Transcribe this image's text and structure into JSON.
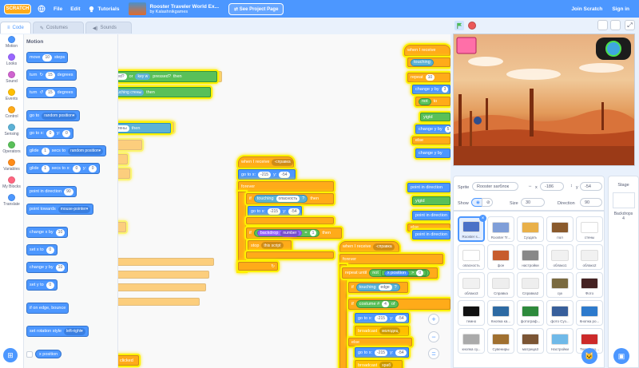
{
  "topbar": {
    "logo": "SCRATCH",
    "file": "File",
    "edit": "Edit",
    "tutorials": "Tutorials",
    "project_title": "Rooster Traveler World Ex...",
    "project_by": "by Kalashnikgames",
    "see_project": "See Project Page",
    "join": "Join Scratch",
    "sign_in": "Sign in"
  },
  "tabs": {
    "code": "Code",
    "costumes": "Costumes",
    "sounds": "Sounds"
  },
  "categories": [
    {
      "label": "Motion",
      "color": "#4c97ff"
    },
    {
      "label": "Looks",
      "color": "#9966ff"
    },
    {
      "label": "Sound",
      "color": "#cf63cf"
    },
    {
      "label": "Events",
      "color": "#ffbf00"
    },
    {
      "label": "Control",
      "color": "#ffab19"
    },
    {
      "label": "Sensing",
      "color": "#5cb1d6"
    },
    {
      "label": "Operators",
      "color": "#59c059"
    },
    {
      "label": "Variables",
      "color": "#ff8c1a"
    },
    {
      "label": "My Blocks",
      "color": "#ff6680"
    },
    {
      "label": "Translate",
      "color": "#4c97ff"
    }
  ],
  "palette": {
    "heading": "Motion",
    "move": {
      "a": "move",
      "v": "10",
      "b": "steps"
    },
    "turn_right": {
      "a": "turn",
      "v": "15",
      "b": "degrees"
    },
    "turn_left": {
      "a": "turn",
      "v": "15",
      "b": "degrees"
    },
    "goto": {
      "a": "go to",
      "d": "random position"
    },
    "gotoxy": {
      "a": "go to x:",
      "x": "0",
      "b": "y:",
      "y": "0"
    },
    "glide": {
      "a": "glide",
      "v": "1",
      "b": "secs to",
      "d": "random position"
    },
    "glidexy": {
      "a": "glide",
      "v": "1",
      "b": "secs to x:",
      "x": "0",
      "c": "y:",
      "y": "0"
    },
    "point_dir": {
      "a": "point in direction",
      "v": "90"
    },
    "point_towards": {
      "a": "point towards",
      "d": "mouse-pointer"
    },
    "change_x": {
      "a": "change x by",
      "v": "10"
    },
    "set_x": {
      "a": "set x to",
      "v": "0"
    },
    "change_y": {
      "a": "change y by",
      "v": "10"
    },
    "set_y": {
      "a": "set y to",
      "v": "0"
    },
    "bounce": "if on edge, bounce",
    "rotation": {
      "a": "set rotation style",
      "d": "left-right"
    },
    "xpos": "x position"
  },
  "workspace": {
    "script1": {
      "hat": "when I receive",
      "hat_msg": "-справка",
      "goto": "go to x:",
      "x": "-215",
      "y_label": "y:",
      "y": "-54",
      "forever": "forever",
      "if1": "if",
      "touching": "touching",
      "touching_arg": "опасность",
      "q": "?",
      "then": "then",
      "backdrop": "backdrop",
      "backdrop_arg": "number",
      "eq": "=",
      "eq_val": "1",
      "stop": "stop",
      "stop_arg": "this script"
    },
    "script2": {
      "hat": "when I receive",
      "hat_msg": "-справка",
      "forever": "forever",
      "repeat_until": "repeat until",
      "not": "not",
      "xpos": "x position",
      "gt": ">",
      "val": "0",
      "touching": "touching",
      "edge": "edge",
      "costume": "costume #",
      "of": "of",
      "num": "4",
      "x": "-215",
      "y": "-54",
      "broadcast": "broadcast",
      "msg1": "молодец",
      "else": "else",
      "msg2": "храб"
    },
    "script3": {
      "hat": "when I receive",
      "touching": "touching",
      "repeat": "repeat",
      "num10": "10",
      "change_y": "change y by",
      "val3": "3",
      "not": "not",
      "to": "to",
      "yigtd": "yigtd",
      "change_y2": "change y by",
      "val5": "5",
      "else": "else",
      "point_dir": "point in direction",
      "dir": "90",
      "dir2": "-90"
    },
    "faded": {
      "pressed": "pressed?",
      "or": "or",
      "key": "key",
      "w": "w",
      "touching_walls": "touching",
      "walls": "стены",
      "then": "then",
      "clicked": "clicked"
    },
    "zoom_in": "+",
    "zoom_out": "−",
    "zoom_reset": "="
  },
  "sprite_info": {
    "sprite_label": "Sprite",
    "sprite_name": "Rooster sarблок",
    "x_label": "x",
    "x": "-186",
    "y_label": "y",
    "y": "-54",
    "show_label": "Show",
    "size_label": "Size",
    "size": "30",
    "direction_label": "Direction",
    "direction": "90"
  },
  "sprites": [
    {
      "name": "Rooster s...",
      "color": "#4b71c7",
      "selected": true
    },
    {
      "name": "Rooster Tr...",
      "color": "#7f9ed8"
    },
    {
      "name": "Cуздать",
      "color": "#e9b048"
    },
    {
      "name": "пол",
      "color": "#8a5a2c"
    },
    {
      "name": "стены",
      "color": "#ffffff"
    },
    {
      "name": "опасность",
      "color": "#ffffff"
    },
    {
      "name": "фон",
      "color": "#c75c2c"
    },
    {
      "name": "настройки",
      "color": "#888888"
    },
    {
      "name": "облако1",
      "color": "#f1f1f1"
    },
    {
      "name": "облако2",
      "color": "#f1f1f1"
    },
    {
      "name": "облако3",
      "color": "#f1f1f1"
    },
    {
      "name": "Справка",
      "color": "#eeeeee"
    },
    {
      "name": "Справка2",
      "color": "#eeeeee"
    },
    {
      "name": "сук",
      "color": "#7a6a40"
    },
    {
      "name": "Фото",
      "color": "#442222"
    },
    {
      "name": "темно",
      "color": "#111111"
    },
    {
      "name": "Кнопка ка...",
      "color": "#2d6aa3"
    },
    {
      "name": "фотограф...",
      "color": "#2e8a3c"
    },
    {
      "name": "фото Cуз...",
      "color": "#385f9b"
    },
    {
      "name": "Кнопка ро...",
      "color": "#2d7acc"
    },
    {
      "name": "кнопка су...",
      "color": "#aaaaaa"
    },
    {
      "name": "Сувениры",
      "color": "#a07030"
    },
    {
      "name": "матрица3",
      "color": "#7b5534"
    },
    {
      "name": "Настройки",
      "color": "#6fb9e8"
    },
    {
      "name": "Телеф ро...",
      "color": "#cc2a2a"
    }
  ],
  "stage_pane": {
    "label": "Stage",
    "backdrops_label": "Backdrops",
    "backdrops": "4"
  },
  "colors": {
    "accent": "#4c97ff",
    "control": "#ffab19",
    "glow": "#fff200"
  }
}
